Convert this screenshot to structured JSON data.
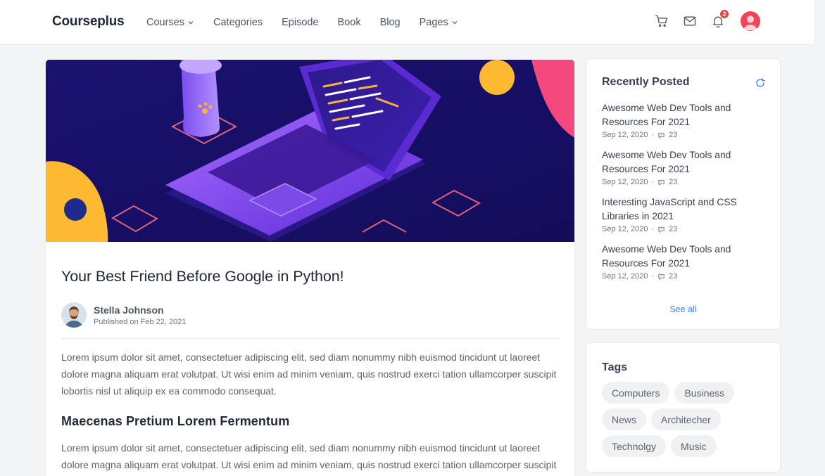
{
  "header": {
    "logo": "Courseplus",
    "nav": [
      {
        "label": "Courses",
        "dropdown": true
      },
      {
        "label": "Categories",
        "dropdown": false
      },
      {
        "label": "Episode",
        "dropdown": false
      },
      {
        "label": "Book",
        "dropdown": false
      },
      {
        "label": "Blog",
        "dropdown": false
      },
      {
        "label": "Pages",
        "dropdown": true
      }
    ],
    "icons": [
      "cart-icon",
      "mail-icon",
      "bell-icon"
    ],
    "notification_count": "2"
  },
  "article": {
    "title": "Your Best Friend Before Google in Python!",
    "author": {
      "name": "Stella Johnson",
      "published": "Published on Feb 22, 2021"
    },
    "paragraph1": "Lorem ipsum dolor sit amet, consectetuer adipiscing elit, sed diam nonummy nibh euismod tincidunt ut laoreet dolore magna aliquam erat volutpat. Ut wisi enim ad minim veniam, quis nostrud exerci tation ullamcorper suscipit lobortis nisl ut aliquip ex ea commodo consequat.",
    "subheading": "Maecenas Pretium Lorem Fermentum",
    "paragraph2": "Lorem ipsum dolor sit amet, consectetuer adipiscing elit, sed diam nonummy nibh euismod tincidunt ut laoreet dolore magna aliquam erat volutpat. Ut wisi enim ad minim veniam, quis nostrud exerci tation ullamcorper suscipit lobortis nisl ut aliquip ex ea commodo consequat."
  },
  "recent": {
    "title": "Recently Posted",
    "posts": [
      {
        "title": "Awesome Web Dev Tools and Resources For 2021",
        "date": "Sep 12, 2020",
        "comments": "23"
      },
      {
        "title": "Awesome Web Dev Tools and Resources For 2021",
        "date": "Sep 12, 2020",
        "comments": "23"
      },
      {
        "title": "Interesting JavaScript and CSS Libraries in 2021",
        "date": "Sep 12, 2020",
        "comments": "23"
      },
      {
        "title": "Awesome Web Dev Tools and Resources For 2021",
        "date": "Sep 12, 2020",
        "comments": "23"
      }
    ],
    "see_all": "See all"
  },
  "tags": {
    "title": "Tags",
    "items": [
      "Computers",
      "Business",
      "News",
      "Architecher",
      "Technolgy",
      "Music"
    ]
  },
  "colors": {
    "accent": "#3b82f6",
    "badge": "#ef4444",
    "avatar": "#f0445b"
  }
}
